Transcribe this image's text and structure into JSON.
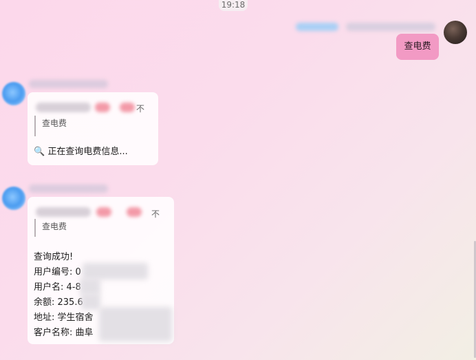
{
  "timestamp": "19:18",
  "outgoing": {
    "text": "查电费"
  },
  "messages": [
    {
      "quote_pin": "不",
      "quoted_text": "查电费",
      "status_icon": "magnifier-icon",
      "status_glyph": "🔍",
      "status_text": "正在查询电费信息..."
    },
    {
      "quote_pin": "不",
      "quoted_text": "查电费",
      "result_lines": [
        "查询成功!",
        "用户编号: 0",
        "用户名: 4-8",
        "余额: 235.6",
        "地址: 学生宿舍",
        "客户名称: 曲阜"
      ]
    }
  ]
}
